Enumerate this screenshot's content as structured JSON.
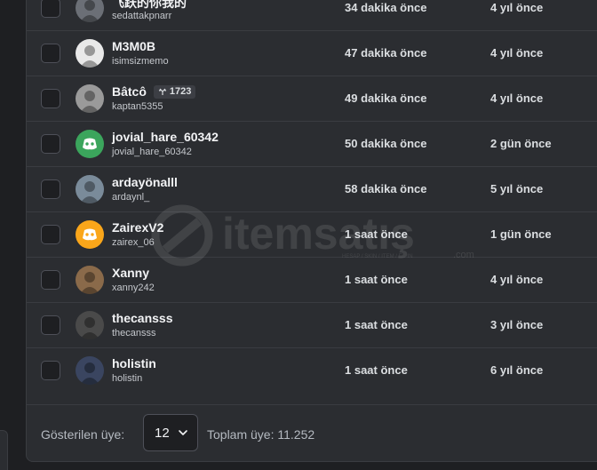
{
  "members": [
    {
      "name": "飞跃的你我的",
      "username": "sedattakpnarr",
      "joined": "34 dakika önce",
      "created": "4 yıl önce",
      "avatar": "photo",
      "avatar_color": "#6b6f76"
    },
    {
      "name": "M3M0B",
      "username": "isimsizmemo",
      "joined": "47 dakika önce",
      "created": "4 yıl önce",
      "avatar": "photo",
      "avatar_color": "#e9e9e9"
    },
    {
      "name": "Bâtcô",
      "badge": "1723",
      "username": "kaptan5355",
      "joined": "49 dakika önce",
      "created": "4 yıl önce",
      "avatar": "photo",
      "avatar_color": "#9a9a9a"
    },
    {
      "name": "jovial_hare_60342",
      "username": "jovial_hare_60342",
      "joined": "50 dakika önce",
      "created": "2 gün önce",
      "avatar": "discord-icon",
      "avatar_color": "#3ba55c"
    },
    {
      "name": "ardayönalll",
      "username": "ardaynl_",
      "joined": "58 dakika önce",
      "created": "5 yıl önce",
      "avatar": "photo",
      "avatar_color": "#7a8b9a"
    },
    {
      "name": "ZairexV2",
      "username": "zairex_06",
      "joined": "1 saat önce",
      "created": "1 gün önce",
      "avatar": "discord-icon",
      "avatar_color": "#faa61a"
    },
    {
      "name": "Xanny",
      "username": "xanny242",
      "joined": "1 saat önce",
      "created": "4 yıl önce",
      "avatar": "photo",
      "avatar_color": "#8a6a4a"
    },
    {
      "name": "thecansss",
      "username": "thecansss",
      "joined": "1 saat önce",
      "created": "3 yıl önce",
      "avatar": "photo",
      "avatar_color": "#4a4a4a"
    },
    {
      "name": "holistin",
      "username": "holistin",
      "joined": "1 saat önce",
      "created": "6 yıl önce",
      "avatar": "photo",
      "avatar_color": "#3a4560"
    }
  ],
  "footer": {
    "shown_label": "Gösterilen üye:",
    "page_size": "12",
    "total": "Toplam üye: 11.252"
  },
  "watermark": {
    "text": "itemsatış",
    "subtext": "HESAP / SKIN / ITEM / E-PIN",
    "domain": ".com"
  }
}
